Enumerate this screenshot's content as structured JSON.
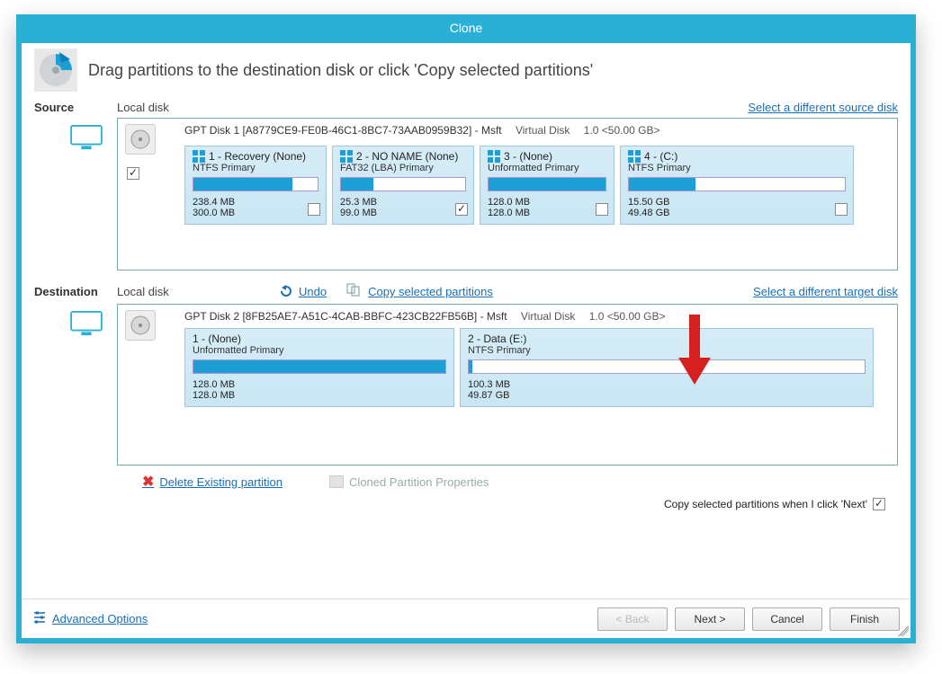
{
  "title": "Clone",
  "instruction": "Drag partitions to the destination disk or click 'Copy selected partitions'",
  "source": {
    "label": "Source",
    "sub": "Local disk",
    "select_link": "Select a different source disk",
    "disk_title": "GPT Disk 1 [A8779CE9-FE0B-46C1-8BC7-73AAB0959B32] - Msft",
    "disk_meta1": "Virtual Disk",
    "disk_meta2": "1.0  <50.00 GB>",
    "select_all_checked": true,
    "partitions": [
      {
        "name": "1 - Recovery (None)",
        "type": "NTFS Primary",
        "used": "238.4 MB",
        "total": "300.0 MB",
        "fill": 80,
        "checked": false,
        "win": true
      },
      {
        "name": "2 - NO NAME (None)",
        "type": "FAT32 (LBA) Primary",
        "used": "25.3 MB",
        "total": "99.0 MB",
        "fill": 26,
        "checked": true,
        "win": true
      },
      {
        "name": "3 -  (None)",
        "type": "Unformatted Primary",
        "used": "128.0 MB",
        "total": "128.0 MB",
        "fill": 100,
        "checked": false,
        "win": true
      },
      {
        "name": "4 -  (C:)",
        "type": "NTFS Primary",
        "used": "15.50 GB",
        "total": "49.48 GB",
        "fill": 31,
        "checked": false,
        "win": true
      }
    ]
  },
  "dest": {
    "label": "Destination",
    "sub": "Local disk",
    "select_link": "Select a different target disk",
    "undo": "Undo",
    "copy": "Copy selected partitions",
    "disk_title": "GPT Disk 2 [8FB25AE7-A51C-4CAB-BBFC-423CB22FB56B] - Msft",
    "disk_meta1": "Virtual Disk",
    "disk_meta2": "1.0  <50.00 GB>",
    "partitions": [
      {
        "name": "1 -  (None)",
        "type": "Unformatted Primary",
        "used": "128.0 MB",
        "total": "128.0 MB",
        "fill": 100
      },
      {
        "name": "2 - Data (E:)",
        "type": "NTFS Primary",
        "used": "100.3 MB",
        "total": "49.87 GB",
        "fill": 1
      }
    ]
  },
  "actions": {
    "delete": "Delete Existing partition",
    "props": "Cloned Partition Properties"
  },
  "bottom": {
    "copy_when_next": "Copy selected partitions when I click 'Next'",
    "copy_when_next_checked": true
  },
  "footer": {
    "advanced": "Advanced Options",
    "back": "< Back",
    "next": "Next >",
    "cancel": "Cancel",
    "finish": "Finish"
  }
}
